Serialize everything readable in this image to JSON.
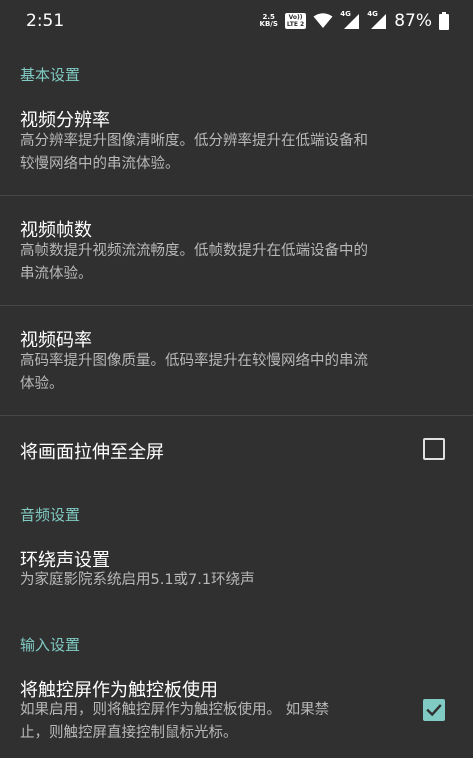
{
  "status_bar": {
    "time": "2:51",
    "net_speed_value": "2.5",
    "net_speed_unit": "KB/S",
    "volte_top": "Vo))",
    "volte_bottom": "LTE 2",
    "signal1_label": "4G",
    "signal2_label": "4G",
    "battery_pct": "87%",
    "icons": [
      "wifi-icon",
      "signal-icon",
      "signal-icon",
      "battery-icon"
    ]
  },
  "sections": {
    "basic": "基本设置",
    "audio": "音频设置",
    "input": "输入设置"
  },
  "prefs": {
    "resolution": {
      "title": "视频分辨率",
      "summary_line1": "高分辨率提升图像清晰度。低分辨率提升在低端设备和",
      "summary_line2": "较慢网络中的串流体验。"
    },
    "framerate": {
      "title": "视频帧数",
      "summary_line1": "高帧数提升视频流流畅度。低帧数提升在低端设备中的",
      "summary_line2": "串流体验。"
    },
    "bitrate": {
      "title": "视频码率",
      "summary_line1": "高码率提升图像质量。低码率提升在较慢网络中的串流",
      "summary_line2": "体验。"
    },
    "stretch": {
      "title": "将画面拉伸至全屏",
      "checked": false
    },
    "surround": {
      "title": "环绕声设置",
      "summary": "为家庭影院系统启用5.1或7.1环绕声"
    },
    "touchpad": {
      "title": "将触控屏作为触控板使用",
      "summary_line1": "如果启用，则将触控屏作为触控板使用。 如果禁",
      "summary_line2": "止，则触控屏直接控制鼠标光标。",
      "checked": true
    }
  },
  "colors": {
    "background": "#303030",
    "accent": "#80cbc4",
    "summary_text": "#b8b8b8",
    "divider": "#474747"
  }
}
